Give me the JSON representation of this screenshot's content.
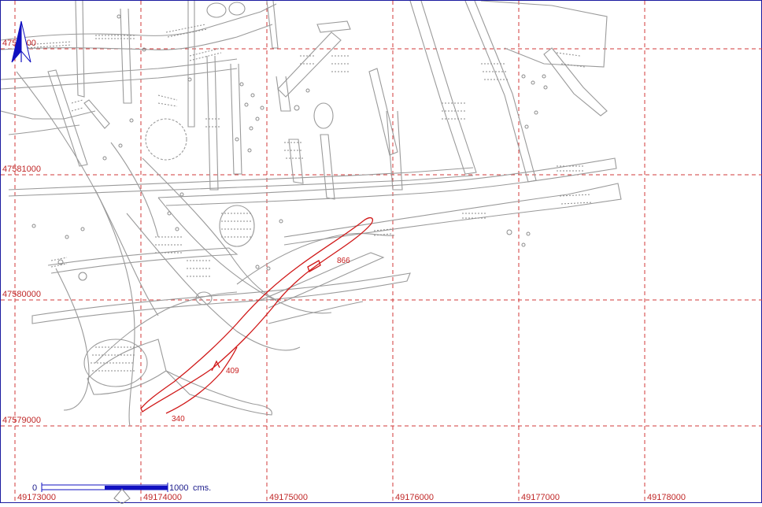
{
  "map": {
    "north_arrow_icon": "north-arrow-icon",
    "grid_color": "#d23a3a",
    "route_color": "#d01818",
    "easting_labels": [
      "49173000",
      "49174000",
      "49175000",
      "49176000",
      "49177000",
      "49178000"
    ],
    "northing_labels": [
      "4758100",
      "47581000",
      "47580000",
      "47579000"
    ],
    "route_labels": [
      "866",
      "409",
      "340"
    ],
    "scale_bar": {
      "start_label": "0",
      "end_label": "1000",
      "unit_label": "cms.",
      "color": "#1010c0"
    }
  }
}
